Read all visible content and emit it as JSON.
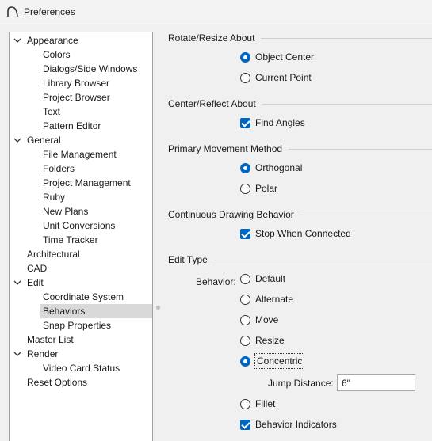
{
  "window": {
    "title": "Preferences"
  },
  "tree": [
    {
      "label": "Appearance",
      "expanded": true
    },
    {
      "label": "Colors"
    },
    {
      "label": "Dialogs/Side Windows"
    },
    {
      "label": "Library Browser"
    },
    {
      "label": "Project Browser"
    },
    {
      "label": "Text"
    },
    {
      "label": "Pattern Editor"
    },
    {
      "label": "General",
      "expanded": true
    },
    {
      "label": "File Management"
    },
    {
      "label": "Folders"
    },
    {
      "label": "Project Management"
    },
    {
      "label": "Ruby"
    },
    {
      "label": "New Plans"
    },
    {
      "label": "Unit Conversions"
    },
    {
      "label": "Time Tracker"
    },
    {
      "label": "Architectural"
    },
    {
      "label": "CAD"
    },
    {
      "label": "Edit",
      "expanded": true
    },
    {
      "label": "Coordinate System"
    },
    {
      "label": "Behaviors",
      "selected": true
    },
    {
      "label": "Snap Properties"
    },
    {
      "label": "Master List"
    },
    {
      "label": "Render",
      "expanded": true
    },
    {
      "label": "Video Card Status"
    },
    {
      "label": "Reset Options"
    }
  ],
  "rotate_resize": {
    "title": "Rotate/Resize About",
    "options": [
      "Object Center",
      "Current Point"
    ],
    "selected": "Object Center"
  },
  "center_reflect": {
    "title": "Center/Reflect About",
    "find_angles": {
      "label": "Find Angles",
      "checked": true
    }
  },
  "primary_movement": {
    "title": "Primary Movement Method",
    "options": [
      "Orthogonal",
      "Polar"
    ],
    "selected": "Orthogonal"
  },
  "continuous_drawing": {
    "title": "Continuous Drawing Behavior",
    "stop_when_connected": {
      "label": "Stop When Connected",
      "checked": true
    }
  },
  "edit_type": {
    "title": "Edit Type",
    "behavior_label": "Behavior:",
    "options": [
      "Default",
      "Alternate",
      "Move",
      "Resize",
      "Concentric",
      "Fillet"
    ],
    "selected": "Concentric",
    "jump_distance_label": "Jump Distance:",
    "jump_distance_value": "6\"",
    "behavior_indicators": {
      "label": "Behavior Indicators",
      "checked": true
    }
  },
  "colors": {
    "accent": "#0067c0",
    "selected_row": "#d9d9d9"
  }
}
